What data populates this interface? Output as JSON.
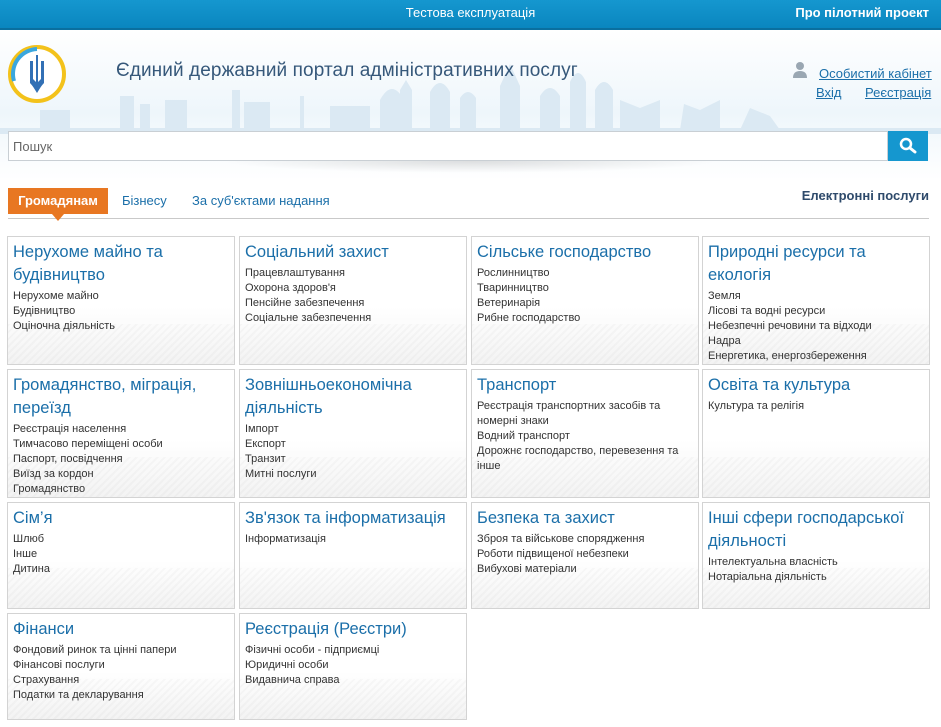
{
  "topbar": {
    "center_text": "Тестова експлуатація",
    "pilot_link": "Про пілотний проект"
  },
  "header": {
    "title": "Єдиний державний портал адміністративних послуг",
    "cabinet_link": "Особистий кабінет",
    "login_link": "Вхід",
    "register_link": "Реєстрація"
  },
  "search": {
    "placeholder": "Пошук"
  },
  "tabs": {
    "citizens": "Громадянам",
    "business": "Бізнесу",
    "by_subject": "За суб'єктами надання",
    "electronic": "Електронні послуги"
  },
  "categories": [
    {
      "title": "Нерухоме майно та будівництво",
      "items": [
        "Нерухоме майно",
        "Будівництво",
        "Оціночна діяльність"
      ]
    },
    {
      "title": "Соціальний захист",
      "items": [
        "Працевлаштування",
        "Охорона здоров'я",
        "Пенсійне забезпечення",
        "Соціальне забезпечення"
      ]
    },
    {
      "title": "Сільське господарство",
      "items": [
        "Рослинництво",
        "Тваринництво",
        "Ветеринарія",
        "Рибне господарство"
      ]
    },
    {
      "title": "Природні ресурси та екологія",
      "items": [
        "Земля",
        "Лісові та водні ресурси",
        "Небезпечні речовини та відходи",
        "Надра",
        "Енергетика, енергозбереження"
      ]
    },
    {
      "title": "Громадянство, міграція, переїзд",
      "items": [
        "Реєстрація населення",
        "Тимчасово переміщені особи",
        "Паспорт, посвідчення",
        "Виїзд за кордон",
        "Громадянство"
      ]
    },
    {
      "title": "Зовнішньоекономічна діяльність",
      "items": [
        "Імпорт",
        "Експорт",
        "Транзит",
        "Митні послуги"
      ]
    },
    {
      "title": "Транспорт",
      "items": [
        "Реєстрація транспортних засобів та номерні знаки",
        "Водний транспорт",
        "Дорожнє господарство, перевезення та інше"
      ]
    },
    {
      "title": "Освіта та культура",
      "items": [
        "Культура та релігія"
      ]
    },
    {
      "title": "Сім’я",
      "items": [
        "Шлюб",
        "Інше",
        "Дитина"
      ]
    },
    {
      "title": "Зв'язок та інформатизація",
      "items": [
        "Інформатизація"
      ]
    },
    {
      "title": "Безпека та захист",
      "items": [
        "Зброя та військове спорядження",
        "Роботи підвищеної небезпеки",
        "Вибухові матеріали"
      ]
    },
    {
      "title": "Інші сфери господарської діяльності",
      "items": [
        "Інтелектуальна власність",
        "Нотаріальна діяльність"
      ]
    },
    {
      "title": "Фінанси",
      "items": [
        "Фондовий ринок та цінні папери",
        "Фінансові послуги",
        "Страхування",
        "Податки та декларування"
      ]
    },
    {
      "title": "Реєстрація (Реєстри)",
      "items": [
        "Фізичні особи - підприємці",
        "Юридичні особи",
        "Видавнича справа"
      ]
    }
  ],
  "colors": {
    "topbar": "#1597cf",
    "accent_tab": "#e87722",
    "link": "#1b6fa9",
    "title": "#36587a"
  },
  "icons": {
    "logo": "ukraine-trident-logo",
    "user": "user-icon",
    "search": "search-icon"
  }
}
